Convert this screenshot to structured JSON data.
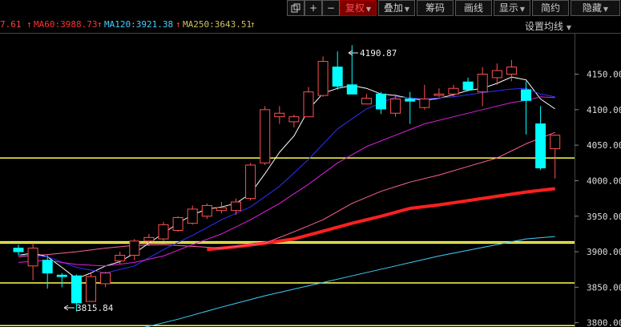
{
  "toolbar": {
    "items": [
      {
        "label": "",
        "icon": "copy-icon"
      },
      {
        "label": "+",
        "icon": "plus-icon"
      },
      {
        "label": "−",
        "icon": "minus-icon"
      },
      {
        "label": "复权",
        "active": true,
        "dropdown": true
      },
      {
        "label": "叠加",
        "dropdown": true
      },
      {
        "label": "筹码"
      },
      {
        "label": "画线"
      },
      {
        "label": "显示",
        "dropdown": true
      },
      {
        "label": "简约"
      },
      {
        "label": "隐藏",
        "dropdown": true
      }
    ]
  },
  "ma_legend": {
    "ma_partial": {
      "text": "7.61",
      "color": "#ff4040"
    },
    "ma60": {
      "text": "MA60:3988.73",
      "color": "#ff3030"
    },
    "ma120": {
      "text": "MA120:3921.38",
      "color": "#40d0ff"
    },
    "ma250": {
      "text": "MA250:3643.51",
      "color": "#d0c060"
    },
    "settings_label": "设置均线"
  },
  "annotations": {
    "high": "4190.87",
    "low": "3815.84"
  },
  "chart_data": {
    "type": "candlestick",
    "y_axis": {
      "ticks": [
        "4150.00",
        "4100.00",
        "4050.00",
        "4000.00",
        "3950.00",
        "3900.00",
        "3850.00",
        "3800.00"
      ],
      "range": [
        3794,
        4207
      ]
    },
    "horizontal_lines": [
      4032,
      3914,
      3912,
      3856,
      3796
    ],
    "candles": [
      {
        "o": 3905,
        "h": 3910,
        "l": 3895,
        "c": 3900
      },
      {
        "o": 3880,
        "h": 3912,
        "l": 3860,
        "c": 3905
      },
      {
        "o": 3888,
        "h": 3895,
        "l": 3848,
        "c": 3870
      },
      {
        "o": 3867,
        "h": 3870,
        "l": 3850,
        "c": 3865
      },
      {
        "o": 3866,
        "h": 3868,
        "l": 3815.84,
        "c": 3828
      },
      {
        "o": 3830,
        "h": 3870,
        "l": 3830,
        "c": 3865
      },
      {
        "o": 3855,
        "h": 3872,
        "l": 3850,
        "c": 3870
      },
      {
        "o": 3887,
        "h": 3900,
        "l": 3882,
        "c": 3895
      },
      {
        "o": 3895,
        "h": 3918,
        "l": 3888,
        "c": 3915
      },
      {
        "o": 3915,
        "h": 3925,
        "l": 3908,
        "c": 3920
      },
      {
        "o": 3918,
        "h": 3942,
        "l": 3915,
        "c": 3938
      },
      {
        "o": 3930,
        "h": 3950,
        "l": 3928,
        "c": 3948
      },
      {
        "o": 3940,
        "h": 3965,
        "l": 3938,
        "c": 3960
      },
      {
        "o": 3950,
        "h": 3968,
        "l": 3946,
        "c": 3965
      },
      {
        "o": 3958,
        "h": 3970,
        "l": 3954,
        "c": 3962
      },
      {
        "o": 3958,
        "h": 3975,
        "l": 3952,
        "c": 3970
      },
      {
        "o": 3975,
        "h": 4025,
        "l": 3972,
        "c": 4022
      },
      {
        "o": 4025,
        "h": 4105,
        "l": 4022,
        "c": 4100
      },
      {
        "o": 4090,
        "h": 4105,
        "l": 4080,
        "c": 4095
      },
      {
        "o": 4083,
        "h": 4093,
        "l": 4075,
        "c": 4090
      },
      {
        "o": 4090,
        "h": 4132,
        "l": 4090,
        "c": 4125
      },
      {
        "o": 4120,
        "h": 4175,
        "l": 4118,
        "c": 4168
      },
      {
        "o": 4160,
        "h": 4182,
        "l": 4128,
        "c": 4133
      },
      {
        "o": 4135,
        "h": 4190.87,
        "l": 4125,
        "c": 4122
      },
      {
        "o": 4108,
        "h": 4122,
        "l": 4108,
        "c": 4116
      },
      {
        "o": 4122,
        "h": 4125,
        "l": 4094,
        "c": 4101
      },
      {
        "o": 4095,
        "h": 4122,
        "l": 4090,
        "c": 4115
      },
      {
        "o": 4115,
        "h": 4125,
        "l": 4080,
        "c": 4112
      },
      {
        "o": 4103,
        "h": 4135,
        "l": 4100,
        "c": 4115
      },
      {
        "o": 4120,
        "h": 4130,
        "l": 4118,
        "c": 4122
      },
      {
        "o": 4122,
        "h": 4135,
        "l": 4118,
        "c": 4130
      },
      {
        "o": 4139,
        "h": 4145,
        "l": 4126,
        "c": 4128
      },
      {
        "o": 4125,
        "h": 4160,
        "l": 4105,
        "c": 4150
      },
      {
        "o": 4145,
        "h": 4165,
        "l": 4135,
        "c": 4155
      },
      {
        "o": 4150,
        "h": 4170,
        "l": 4140,
        "c": 4160
      },
      {
        "o": 4128,
        "h": 4140,
        "l": 4065,
        "c": 4113
      },
      {
        "o": 4080,
        "h": 4105,
        "l": 4015,
        "c": 4018
      },
      {
        "o": 4045,
        "h": 4065,
        "l": 4003,
        "c": 4064
      }
    ],
    "ma_series": [
      {
        "name": "MA60",
        "color": "#ff2020",
        "width": 4,
        "points": [
          [
            13,
            3903
          ],
          [
            15,
            3907
          ],
          [
            17,
            3912
          ],
          [
            19,
            3918
          ],
          [
            21,
            3929
          ],
          [
            23,
            3940
          ],
          [
            25,
            3950
          ],
          [
            27,
            3961
          ],
          [
            29,
            3966
          ],
          [
            31,
            3972
          ],
          [
            33,
            3978
          ],
          [
            35,
            3984
          ],
          [
            37,
            3988.73
          ]
        ]
      },
      {
        "name": "MA120",
        "color": "#40d0ff",
        "width": 1,
        "points": [
          [
            8,
            3790
          ],
          [
            11,
            3805
          ],
          [
            14,
            3822
          ],
          [
            17,
            3838
          ],
          [
            20,
            3852
          ],
          [
            23,
            3866
          ],
          [
            26,
            3880
          ],
          [
            29,
            3894
          ],
          [
            32,
            3906
          ],
          [
            35,
            3918
          ],
          [
            37,
            3921.38
          ]
        ]
      },
      {
        "name": "MA250",
        "color": "#ff60a0",
        "width": 1,
        "points": [
          [
            0,
            3893
          ],
          [
            2,
            3896
          ],
          [
            4,
            3900
          ],
          [
            6,
            3905
          ],
          [
            8,
            3909
          ],
          [
            10,
            3910
          ],
          [
            14,
            3905
          ],
          [
            17,
            3912
          ],
          [
            19,
            3928
          ],
          [
            21,
            3945
          ],
          [
            23,
            3968
          ],
          [
            25,
            3985
          ],
          [
            27,
            3998
          ],
          [
            29,
            4008
          ],
          [
            31,
            4020
          ],
          [
            33,
            4032
          ],
          [
            35,
            4052
          ],
          [
            37,
            4068
          ]
        ]
      },
      {
        "name": "MA5",
        "color": "#ffffff",
        "width": 1,
        "points": [
          [
            0,
            3895
          ],
          [
            1,
            3898
          ],
          [
            2,
            3893
          ],
          [
            3,
            3878
          ],
          [
            4,
            3862
          ],
          [
            5,
            3870
          ],
          [
            6,
            3880
          ],
          [
            7,
            3886
          ],
          [
            8,
            3898
          ],
          [
            9,
            3912
          ],
          [
            10,
            3926
          ],
          [
            11,
            3940
          ],
          [
            12,
            3952
          ],
          [
            13,
            3960
          ],
          [
            14,
            3963
          ],
          [
            15,
            3968
          ],
          [
            16,
            3982
          ],
          [
            17,
            4010
          ],
          [
            18,
            4040
          ],
          [
            19,
            4063
          ],
          [
            20,
            4100
          ],
          [
            21,
            4123
          ],
          [
            22,
            4130
          ],
          [
            23,
            4134
          ],
          [
            24,
            4130
          ],
          [
            25,
            4122
          ],
          [
            26,
            4120
          ],
          [
            27,
            4116
          ],
          [
            28,
            4113
          ],
          [
            29,
            4116
          ],
          [
            30,
            4121
          ],
          [
            31,
            4127
          ],
          [
            32,
            4130
          ],
          [
            33,
            4137
          ],
          [
            34,
            4146
          ],
          [
            35,
            4142
          ],
          [
            36,
            4115
          ],
          [
            37,
            4101
          ]
        ]
      },
      {
        "name": "MA10",
        "color": "#3030ff",
        "width": 1,
        "points": [
          [
            0,
            3895
          ],
          [
            2,
            3893
          ],
          [
            4,
            3878
          ],
          [
            6,
            3870
          ],
          [
            8,
            3880
          ],
          [
            10,
            3903
          ],
          [
            12,
            3923
          ],
          [
            14,
            3945
          ],
          [
            16,
            3963
          ],
          [
            18,
            3992
          ],
          [
            20,
            4030
          ],
          [
            22,
            4073
          ],
          [
            24,
            4101
          ],
          [
            26,
            4118
          ],
          [
            28,
            4115
          ],
          [
            30,
            4118
          ],
          [
            32,
            4124
          ],
          [
            34,
            4129
          ],
          [
            35,
            4130
          ],
          [
            36,
            4122
          ],
          [
            37,
            4118
          ]
        ]
      },
      {
        "name": "MA20",
        "color": "#e020e0",
        "width": 1,
        "points": [
          [
            0,
            3885
          ],
          [
            2,
            3888
          ],
          [
            4,
            3882
          ],
          [
            6,
            3880
          ],
          [
            8,
            3885
          ],
          [
            10,
            3894
          ],
          [
            12,
            3910
          ],
          [
            14,
            3925
          ],
          [
            16,
            3945
          ],
          [
            18,
            3968
          ],
          [
            20,
            3995
          ],
          [
            22,
            4025
          ],
          [
            24,
            4048
          ],
          [
            26,
            4064
          ],
          [
            28,
            4080
          ],
          [
            30,
            4090
          ],
          [
            32,
            4100
          ],
          [
            34,
            4110
          ],
          [
            35,
            4113
          ],
          [
            36,
            4118
          ],
          [
            37,
            4117
          ]
        ]
      }
    ]
  }
}
